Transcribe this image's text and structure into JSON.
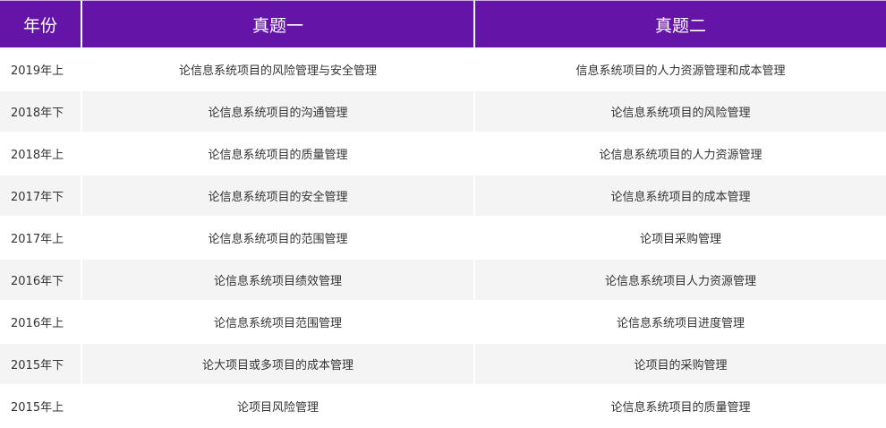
{
  "table": {
    "headers": [
      "年份",
      "真题一",
      "真题二"
    ],
    "rows": [
      {
        "year": "2019年上",
        "q1": "论信息系统项目的风险管理与安全管理",
        "q2": "信息系统项目的人力资源管理和成本管理"
      },
      {
        "year": "2018年下",
        "q1": "论信息系统项目的沟通管理",
        "q2": "论信息系统项目的风险管理"
      },
      {
        "year": "2018年上",
        "q1": "论信息系统项目的质量管理",
        "q2": "论信息系统项目的人力资源管理"
      },
      {
        "year": "2017年下",
        "q1": "论信息系统项目的安全管理",
        "q2": "论信息系统项目的成本管理"
      },
      {
        "year": "2017年上",
        "q1": "论信息系统项目的范围管理",
        "q2": "论项目采购管理"
      },
      {
        "year": "2016年下",
        "q1": "论信息系统项目绩效管理",
        "q2": "论信息系统项目人力资源管理"
      },
      {
        "year": "2016年上",
        "q1": "论信息系统项目范围管理",
        "q2": "论信息系统项目进度管理"
      },
      {
        "year": "2015年下",
        "q1": "论大项目或多项目的成本管理",
        "q2": "论项目的采购管理"
      },
      {
        "year": "2015年上",
        "q1": "论项目风险管理",
        "q2": "论信息系统项目的质量管理"
      }
    ]
  },
  "colors": {
    "header_bg": "#6414a6",
    "header_text": "#ffffff",
    "row_alt_bg": "#f4f4f4",
    "row_bg": "#ffffff",
    "body_text": "#333333"
  }
}
